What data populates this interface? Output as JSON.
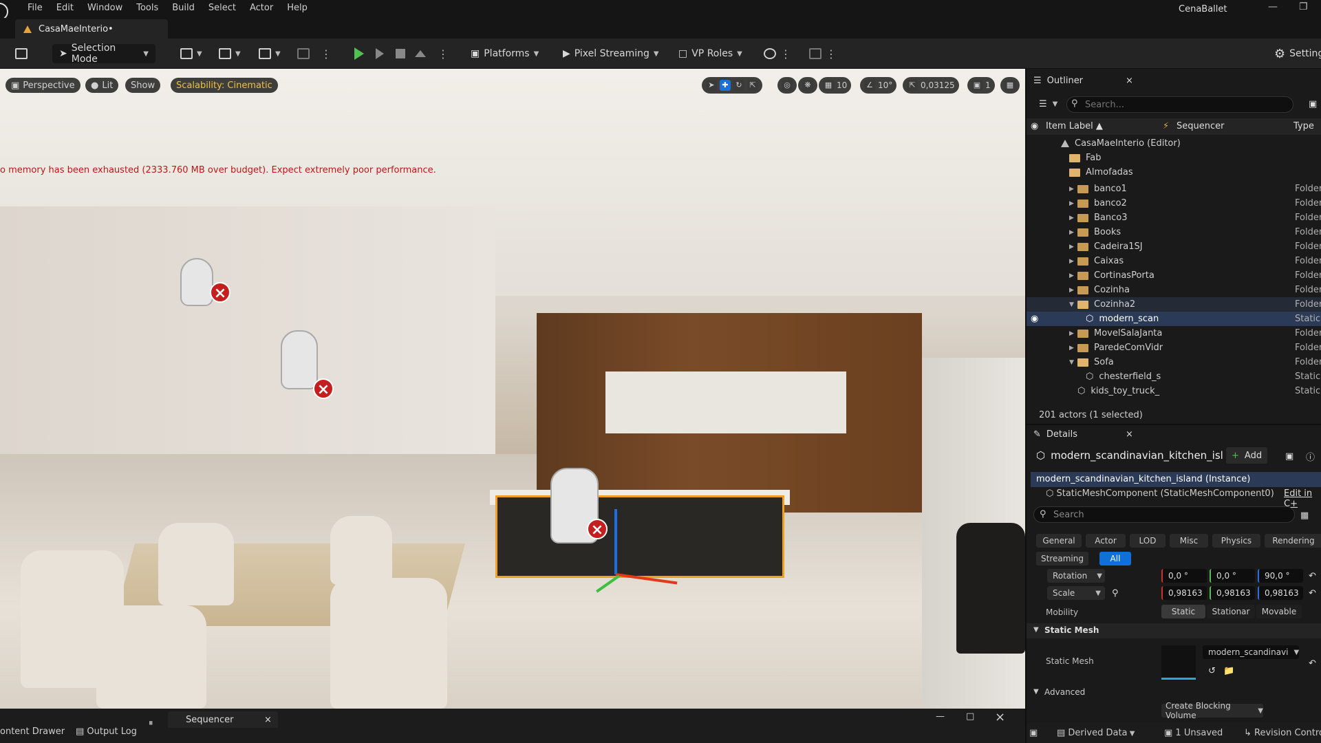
{
  "menubar": {
    "items": [
      "File",
      "Edit",
      "Window",
      "Tools",
      "Build",
      "Select",
      "Actor",
      "Help"
    ],
    "project_name": "CenaBallet"
  },
  "tabs": {
    "level_tab": "CasaMaeInterio•"
  },
  "toolbar": {
    "selection_mode": "Selection Mode",
    "platforms": "Platforms",
    "pixel_streaming": "Pixel Streaming",
    "vp_roles": "VP Roles",
    "settings": "Settings"
  },
  "viewport": {
    "perspective": "Perspective",
    "lit": "Lit",
    "show": "Show",
    "scalability": "Scalability: Cinematic",
    "grid_snap": "10",
    "rotation_snap": "10°",
    "scale_snap": "0,03125",
    "camera_speed": "1",
    "warning": "o memory has been exhausted (2333.760 MB over budget). Expect extremely poor performance."
  },
  "bottombar": {
    "content_drawer": "ontent Drawer",
    "output_log": "Output Log",
    "sequencer_tab": "Sequencer",
    "derived_data": "Derived Data",
    "unsaved": "1 Unsaved",
    "revision_control": "Revision Contro"
  },
  "outliner": {
    "title": "Outliner",
    "search_placeholder": "Search...",
    "col_label": "Item Label ▲",
    "col_sequencer": "Sequencer",
    "col_type": "Type",
    "root": "CasaMaeInterio (Editor)",
    "rows": [
      {
        "label": "Fab",
        "type": ""
      },
      {
        "label": "Almofadas",
        "type": ""
      },
      {
        "label": "banco1",
        "type": "Folder"
      },
      {
        "label": "banco2",
        "type": "Folder"
      },
      {
        "label": "Banco3",
        "type": "Folder"
      },
      {
        "label": "Books",
        "type": "Folder"
      },
      {
        "label": "Cadeira1SJ",
        "type": "Folder"
      },
      {
        "label": "Caixas",
        "type": "Folder"
      },
      {
        "label": "CortinasPorta",
        "type": "Folder"
      },
      {
        "label": "Cozinha",
        "type": "Folder"
      },
      {
        "label": "Cozinha2",
        "type": "Folder"
      },
      {
        "label": "modern_scan",
        "type": "StaticM"
      },
      {
        "label": "MovelSalaJanta",
        "type": "Folder"
      },
      {
        "label": "ParedeComVidr",
        "type": "Folder"
      },
      {
        "label": "Sofa",
        "type": "Folder"
      },
      {
        "label": "chesterfield_s",
        "type": "StaticM"
      },
      {
        "label": "kids_toy_truck_",
        "type": "StaticM"
      }
    ],
    "actors_count": "201 actors (1 selected)"
  },
  "details": {
    "title": "Details",
    "actor_name": "modern_scandinavian_kitchen_isl",
    "add_button": "Add",
    "instance": "modern_scandinavian_kitchen_island (Instance)",
    "component": "StaticMeshComponent (StaticMeshComponent0)",
    "edit_link": "Edit in C+",
    "search_placeholder": "Search",
    "filters": [
      "General",
      "Actor",
      "LOD",
      "Misc",
      "Physics",
      "Rendering",
      "Streaming",
      "All"
    ],
    "rotation_label": "Rotation",
    "rotation": [
      "0,0 °",
      "0,0 °",
      "90,0 °"
    ],
    "scale_label": "Scale",
    "scale": [
      "0,98163",
      "0,98163",
      "0,98163"
    ],
    "mobility_label": "Mobility",
    "mobility": [
      "Static",
      "Stationar",
      "Movable"
    ],
    "static_mesh_section": "Static Mesh",
    "static_mesh_label": "Static Mesh",
    "static_mesh_value": "modern_scandinavi",
    "advanced": "Advanced",
    "create_blocking": "Create Blocking Volume"
  },
  "colors": {
    "accent": "#0f70d7",
    "warning": "#c01818",
    "selection": "#f0a020"
  }
}
